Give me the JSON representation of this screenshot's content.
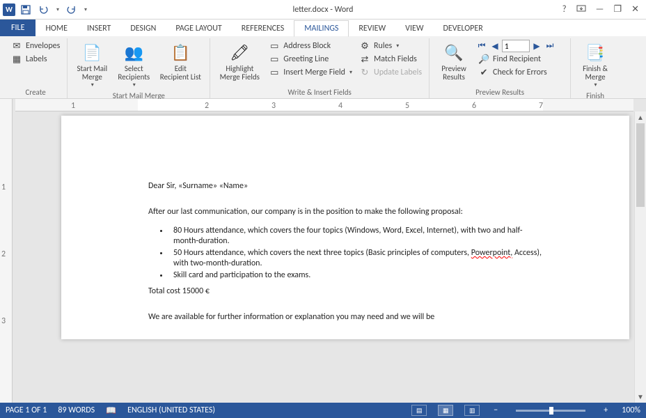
{
  "app": {
    "title": "letter.docx - Word"
  },
  "qat": {
    "save": "Save",
    "undo": "Undo",
    "redo": "Redo"
  },
  "win": {
    "help": "?",
    "ribbon_opts": "▭",
    "min": "—",
    "restore": "❐",
    "close": "✕"
  },
  "tabs": {
    "file": "FILE",
    "home": "HOME",
    "insert": "INSERT",
    "design": "DESIGN",
    "pagelayout": "PAGE LAYOUT",
    "references": "REFERENCES",
    "mailings": "MAILINGS",
    "review": "REVIEW",
    "view": "VIEW",
    "developer": "DEVELOPER"
  },
  "ribbon": {
    "create": {
      "label": "Create",
      "envelopes": "Envelopes",
      "labels": "Labels"
    },
    "startmm": {
      "label": "Start Mail Merge",
      "start": "Start Mail\nMerge",
      "select": "Select\nRecipients",
      "edit": "Edit\nRecipient List"
    },
    "write": {
      "label": "Write & Insert Fields",
      "highlight": "Highlight\nMerge Fields",
      "addrblock": "Address Block",
      "greeting": "Greeting Line",
      "insertfield": "Insert Merge Field",
      "rules": "Rules",
      "match": "Match Fields",
      "update": "Update Labels"
    },
    "preview": {
      "label": "Preview Results",
      "preview": "Preview\nResults",
      "record_value": "1",
      "find": "Find Recipient",
      "check": "Check for Errors"
    },
    "finish": {
      "label": "Finish",
      "finish": "Finish &\nMerge"
    }
  },
  "document": {
    "greeting": "Dear Sir, «Surname» «Name»",
    "intro": "After our last communication, our company is in the position to make the following proposal:",
    "bullets": [
      {
        "pre": "80 Hours attendance, which covers the four topics (Windows, Word, Excel, Internet), with two and half-month-duration."
      },
      {
        "pre": "50 Hours attendance, which covers the next three topics (Basic principles of computers, ",
        "err": "Powerpoint,",
        "post": " Access), with two-month-duration."
      },
      {
        "pre": "Skill card and participation to the exams."
      }
    ],
    "total": "Total cost 15000 €",
    "closing": "We are available for further information or explanation you may need and we will be"
  },
  "status": {
    "page": "PAGE 1 OF 1",
    "words": "89 WORDS",
    "lang": "ENGLISH (UNITED STATES)",
    "zoom": "100%"
  },
  "ruler": {
    "h": [
      "1",
      "2",
      "3",
      "4",
      "5",
      "6",
      "7"
    ],
    "v": [
      "1",
      "2",
      "3"
    ]
  }
}
